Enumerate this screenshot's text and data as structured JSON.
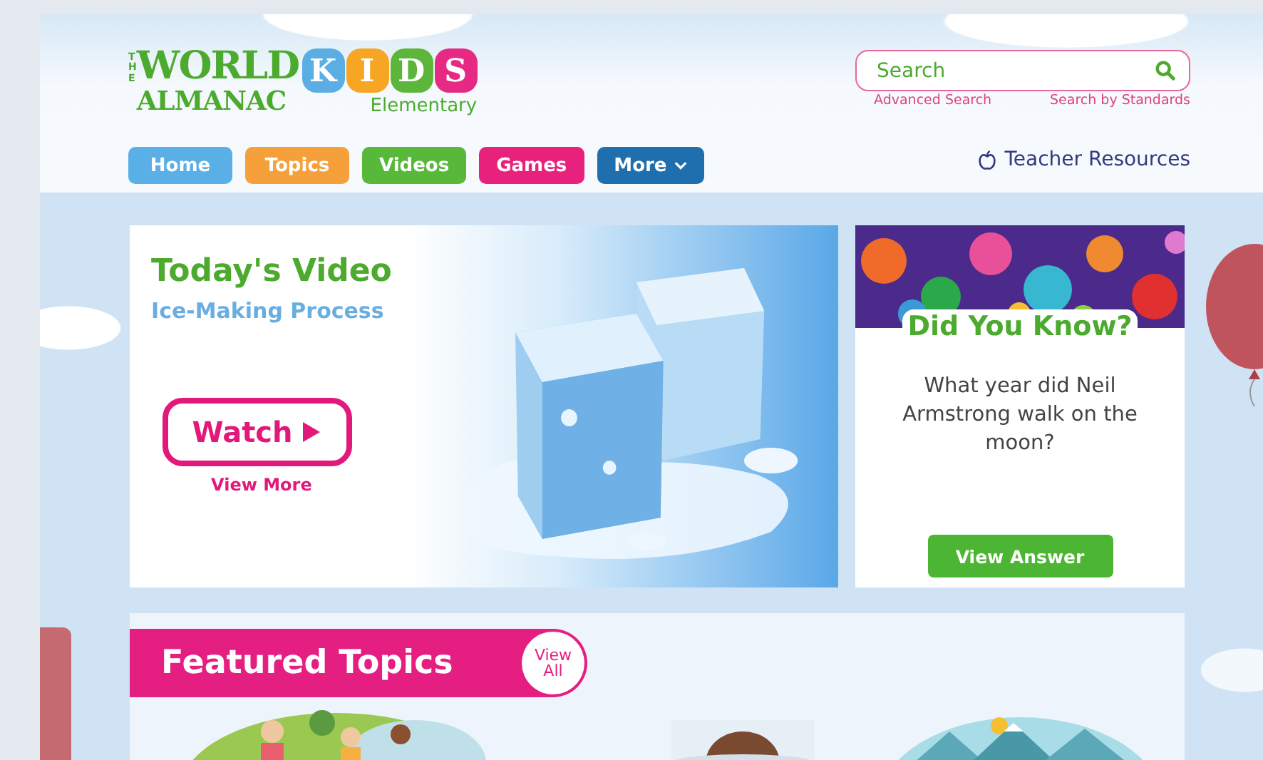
{
  "logo": {
    "the": "THE",
    "world": "WORLD",
    "almanac": "ALMANAC",
    "kids": [
      {
        "letter": "K",
        "color": "#5aaee4"
      },
      {
        "letter": "I",
        "color": "#f6a623"
      },
      {
        "letter": "D",
        "color": "#5cb63a"
      },
      {
        "letter": "S",
        "color": "#e62a84"
      }
    ],
    "edition": "Elementary"
  },
  "nav": [
    {
      "label": "Home",
      "color": "#5ab0e6",
      "kind": "link"
    },
    {
      "label": "Topics",
      "color": "#f5a03a",
      "kind": "link"
    },
    {
      "label": "Videos",
      "color": "#58b83a",
      "kind": "link"
    },
    {
      "label": "Games",
      "color": "#e8227c",
      "kind": "link"
    },
    {
      "label": "More",
      "color": "#1f6fae",
      "kind": "dropdown"
    }
  ],
  "search": {
    "placeholder": "Search",
    "links": [
      "Advanced Search",
      "Search by Standards"
    ]
  },
  "teacher_link": "Teacher Resources",
  "video": {
    "heading": "Today's Video",
    "title": "Ice-Making Process",
    "watch": "Watch",
    "more": "View More"
  },
  "did_you_know": {
    "heading": "Did You Know?",
    "question": "What year did Neil Armstrong walk on the moon?",
    "button": "View Answer"
  },
  "featured": {
    "heading": "Featured Topics",
    "view_all": "View All"
  }
}
